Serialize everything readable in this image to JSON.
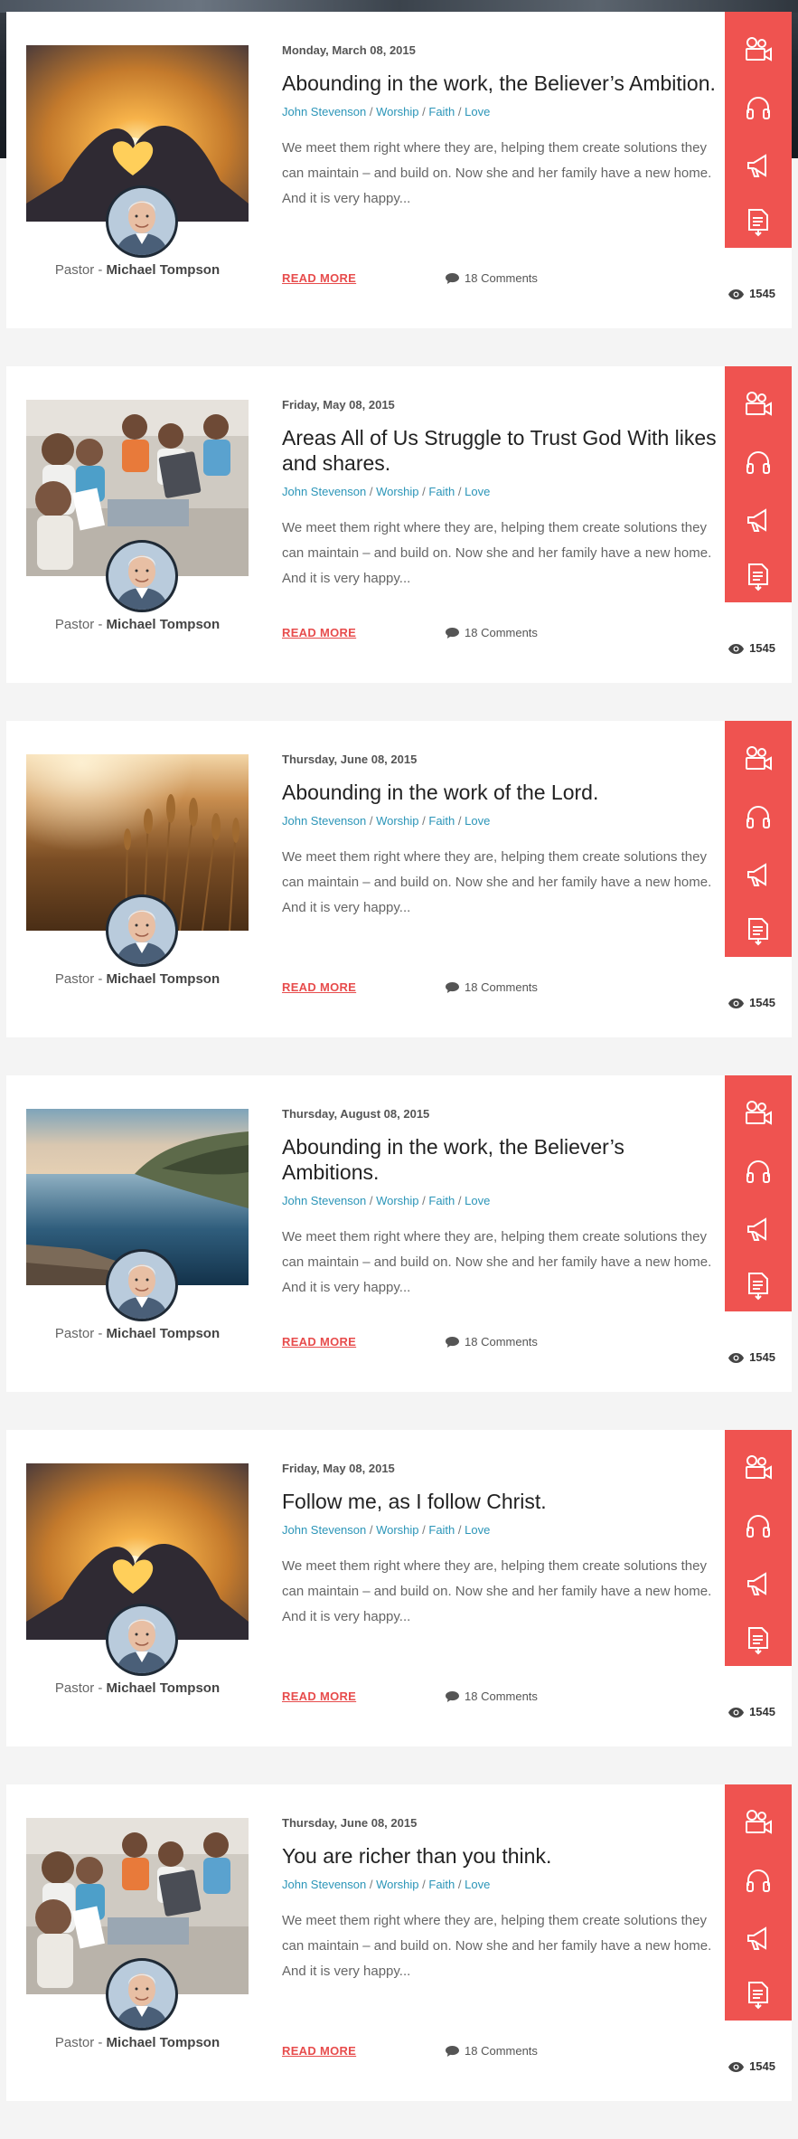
{
  "feed": {
    "read_more_label": "READ MORE",
    "pastor_prefix": "Pastor -",
    "pastor_name": "Michael Tompson",
    "accent_color": "#ef5350",
    "link_color": "#2b95b8",
    "action_icons": [
      "video-camera-icon",
      "headphones-icon",
      "megaphone-icon",
      "document-icon"
    ],
    "posts": [
      {
        "date": "Monday, March 08, 2015",
        "title": "Abounding in the work, the Believer’s Ambition.",
        "tags": [
          "John Stevenson",
          "Worship",
          "Faith",
          "Love"
        ],
        "excerpt": "We meet them right where they are, helping them create solutions they can maintain – and build on. Now she and her family have a new home. And it is very happy...",
        "comments": "18 Comments",
        "views": "1545",
        "image": "heart-hands-sunset"
      },
      {
        "date": "Friday, May 08, 2015",
        "title": "Areas All of Us Struggle to Trust God With likes and shares.",
        "tags": [
          "John Stevenson",
          "Worship",
          "Faith",
          "Love"
        ],
        "excerpt": "We meet them right where they are, helping them create solutions they can maintain – and build on. Now she and her family have a new home. And it is very happy...",
        "comments": "18 Comments",
        "views": "1545",
        "image": "children-classroom"
      },
      {
        "date": "Thursday, June 08, 2015",
        "title": "Abounding in the work of the Lord.",
        "tags": [
          "John Stevenson",
          "Worship",
          "Faith",
          "Love"
        ],
        "excerpt": "We meet them right where they are, helping them create solutions they can maintain – and build on. Now she and her family have a new home. And it is very happy...",
        "comments": "18 Comments",
        "views": "1545",
        "image": "wheat-field"
      },
      {
        "date": "Thursday, August 08, 2015",
        "title": "Abounding in the work, the Believer’s Ambitions.",
        "tags": [
          "John Stevenson",
          "Worship",
          "Faith",
          "Love"
        ],
        "excerpt": "We meet them right where they are, helping them create solutions they can maintain – and build on. Now she and her family have a new home. And it is very happy...",
        "comments": "18 Comments",
        "views": "1545",
        "image": "lake-landscape"
      },
      {
        "date": "Friday, May 08, 2015",
        "title": "Follow me, as I follow Christ.",
        "tags": [
          "John Stevenson",
          "Worship",
          "Faith",
          "Love"
        ],
        "excerpt": "We meet them right where they are, helping them create solutions they can maintain – and build on. Now she and her family have a new home. And it is very happy...",
        "comments": "18 Comments",
        "views": "1545",
        "image": "heart-hands-sunset"
      },
      {
        "date": "Thursday, June 08, 2015",
        "title": "You are richer than you think.",
        "tags": [
          "John Stevenson",
          "Worship",
          "Faith",
          "Love"
        ],
        "excerpt": "We meet them right where they are, helping them create solutions they can maintain – and build on. Now she and her family have a new home. And it is very happy...",
        "comments": "18 Comments",
        "views": "1545",
        "image": "children-classroom"
      }
    ]
  }
}
